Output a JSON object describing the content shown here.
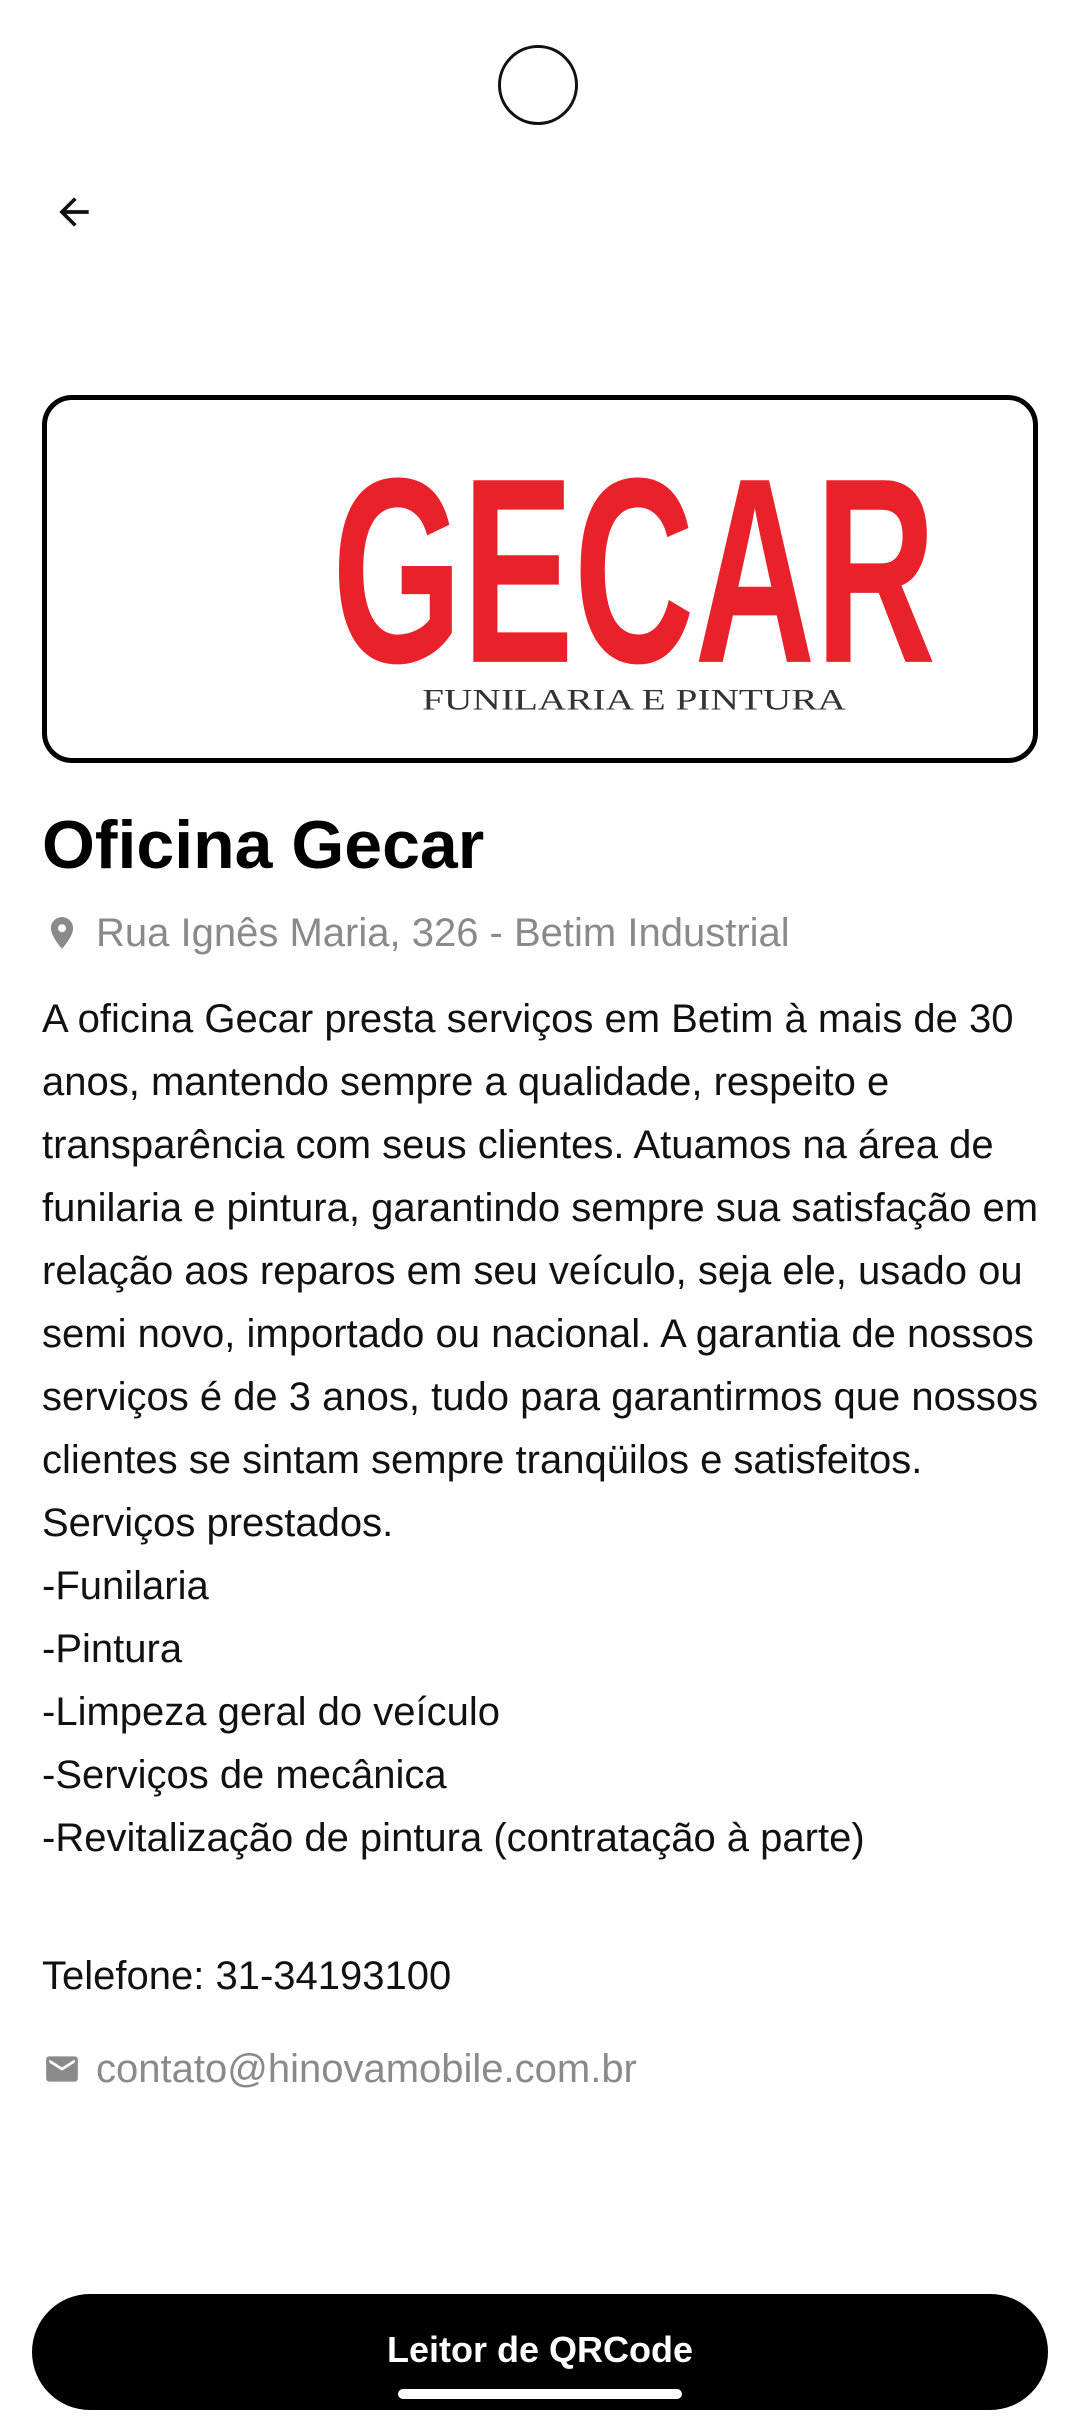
{
  "header": {
    "back_icon": "arrow-left-icon"
  },
  "logo": {
    "brand_text": "GECAR",
    "tagline": "FUNILARIA E PINTURA",
    "brand_color": "#E8212B",
    "tagline_color": "#333333"
  },
  "workshop": {
    "name": "Oficina Gecar",
    "address_icon": "location-pin-icon",
    "address": "Rua Ignês Maria, 326 - Betim Industrial",
    "description": "A oficina Gecar presta serviços em Betim à mais de 30 anos, mantendo sempre a qualidade, respeito e transparência com seus clientes. Atuamos na área de funilaria e pintura, garantindo sempre sua satisfação em relação aos reparos em seu veículo, seja ele, usado ou semi novo, importado ou nacional. A garantia de nossos serviços é de 3 anos, tudo para garantirmos que nossos clientes se sintam sempre tranqüilos e satisfeitos. Serviços prestados.\n-Funilaria\n-Pintura\n-Limpeza geral do veículo\n-Serviços de mecânica\n-Revitalização de pintura (contratação à parte)",
    "phone": "Telefone: 31-34193100",
    "email_icon": "mail-icon",
    "email": "contato@hinovamobile.com.br"
  },
  "actions": {
    "qr_button_label": "Leitor de QRCode"
  },
  "colors": {
    "background": "#FFFFFF",
    "primary_button": "#000000",
    "secondary_text": "#8A8A8A"
  }
}
